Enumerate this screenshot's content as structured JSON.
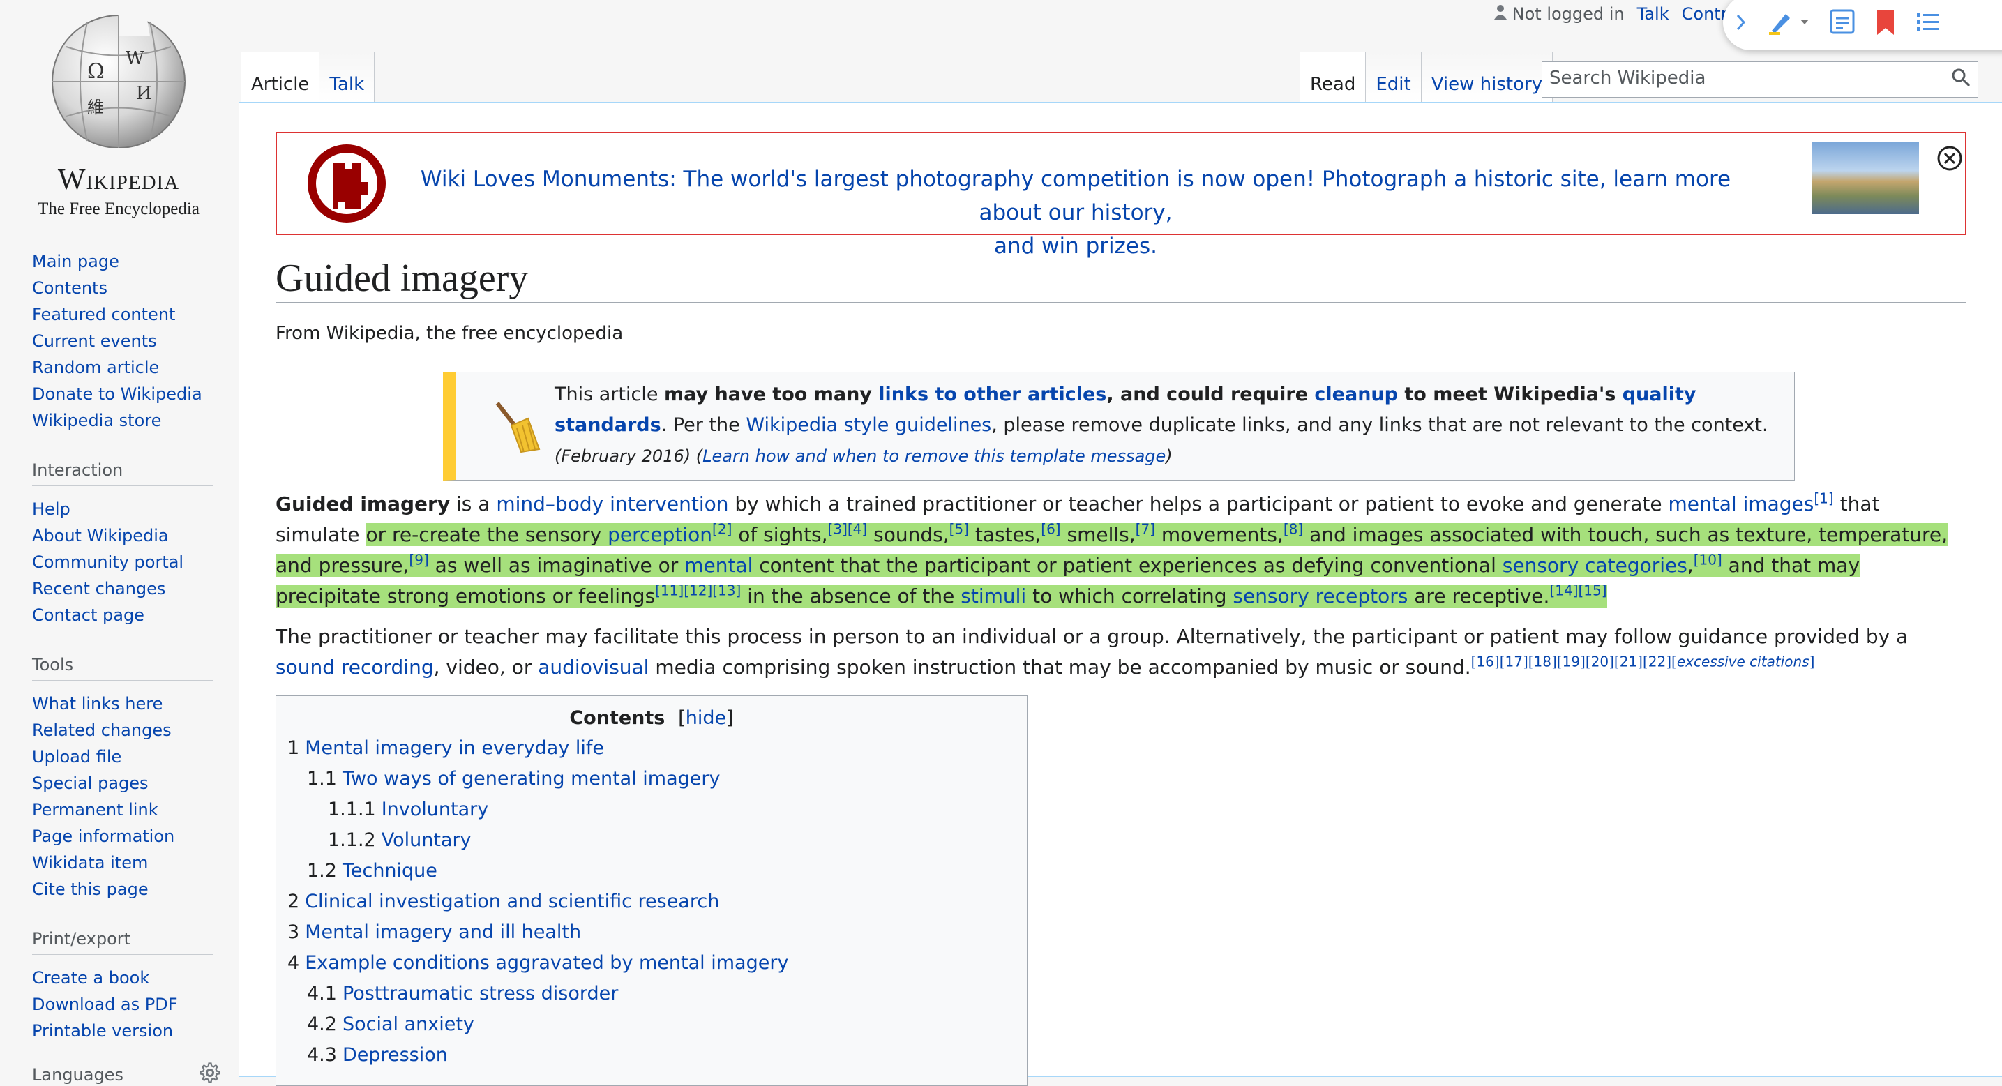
{
  "logo": {
    "wordmark": "Wikipedia",
    "tagline": "The Free Encyclopedia"
  },
  "personal": {
    "status": "Not logged in",
    "talk": "Talk",
    "contrib": "Contri"
  },
  "tabs": {
    "article": "Article",
    "talk": "Talk",
    "read": "Read",
    "edit": "Edit",
    "history": "View history"
  },
  "search": {
    "placeholder": "Search Wikipedia"
  },
  "sidebar": {
    "navigation": [
      "Main page",
      "Contents",
      "Featured content",
      "Current events",
      "Random article",
      "Donate to Wikipedia",
      "Wikipedia store"
    ],
    "interaction_heading": "Interaction",
    "interaction": [
      "Help",
      "About Wikipedia",
      "Community portal",
      "Recent changes",
      "Contact page"
    ],
    "tools_heading": "Tools",
    "tools": [
      "What links here",
      "Related changes",
      "Upload file",
      "Special pages",
      "Permanent link",
      "Page information",
      "Wikidata item",
      "Cite this page"
    ],
    "print_heading": "Print/export",
    "print": [
      "Create a book",
      "Download as PDF",
      "Printable version"
    ],
    "languages_heading": "Languages"
  },
  "banner": {
    "line1": "Wiki Loves Monuments: The world's largest photography competition is now open! Photograph a historic site, learn more about our history,",
    "line2": "and win prizes."
  },
  "page": {
    "title": "Guided imagery",
    "subtitle": "From Wikipedia, the free encyclopedia"
  },
  "ambox": {
    "t1": "This article ",
    "b1": "may have too many ",
    "l1": "links to other articles",
    "b2": ", and could require ",
    "l2": "cleanup",
    "b3": " to meet Wikipedia's ",
    "l3": "quality standards",
    "t2": ". Per the ",
    "l4": "Wikipedia style guidelines",
    "t3": ", please remove duplicate links, and any links that are not relevant to the context. ",
    "date": "(February 2016)",
    "learn_open": " (",
    "learn": "Learn how and when to remove this template message",
    "learn_close": ")"
  },
  "p1": {
    "bold": "Guided imagery",
    "t1": " is a ",
    "l1": "mind–body intervention",
    "t2": " by which a trained practitioner or teacher helps a participant or patient to evoke and generate ",
    "l2": "mental images",
    "r1": "[1]",
    "t3": " that simulate ",
    "h1": "or re-create the sensory ",
    "l3": "perception",
    "r2": "[2]",
    "h2": " of sights,",
    "r3": "[3][4]",
    "h3": " sounds,",
    "r5": "[5]",
    "h4": " tastes,",
    "r6": "[6]",
    "h5": " smells,",
    "r7": "[7]",
    "h6": " movements,",
    "r8": "[8]",
    "h7": " and images associated with touch, such as texture, temperature, and pressure,",
    "r9": "[9]",
    "h8": " as well as imaginative or ",
    "l4": "mental",
    "h9": " content that the participant or patient experiences as defying conventional ",
    "l5": "sensory categories",
    "h10": ",",
    "r10": "[10]",
    "h11": " and that may precipitate strong emotions or feelings",
    "r11": "[11][12][13]",
    "h12": " in the absence of the ",
    "l6": "stimuli",
    "h13": " to which correlating ",
    "l7": "sensory receptors",
    "h14": " are receptive.",
    "r14": "[14][15]"
  },
  "p2": {
    "t1": "The practitioner or teacher may facilitate this process in person to an individual or a group. Alternatively, the participant or patient may follow guidance provided by a ",
    "l1": "sound recording",
    "t2": ", video, or ",
    "l2": "audiovisual",
    "t3": " media comprising spoken instruction that may be accompanied by music or sound.",
    "refs": "[16][17][18][19][20][21][22]",
    "xs_open": "[",
    "xs": "excessive citations",
    "xs_close": "]"
  },
  "toc": {
    "title": "Contents",
    "hide_open": "[",
    "hide": "hide",
    "hide_close": "]",
    "items": [
      {
        "num": "1",
        "label": "Mental imagery in everyday life"
      },
      {
        "num": "1.1",
        "label": "Two ways of generating mental imagery"
      },
      {
        "num": "1.1.1",
        "label": "Involuntary"
      },
      {
        "num": "1.1.2",
        "label": "Voluntary"
      },
      {
        "num": "1.2",
        "label": "Technique"
      },
      {
        "num": "2",
        "label": "Clinical investigation and scientific research"
      },
      {
        "num": "3",
        "label": "Mental imagery and ill health"
      },
      {
        "num": "4",
        "label": "Example conditions aggravated by mental imagery"
      },
      {
        "num": "4.1",
        "label": "Posttraumatic stress disorder"
      },
      {
        "num": "4.2",
        "label": "Social anxiety"
      },
      {
        "num": "4.3",
        "label": "Depression"
      }
    ]
  },
  "colors": {
    "link": "#0645ad",
    "highlight": "#a6e07c",
    "banner_border": "#dd3333",
    "ambox_stripe": "#ffcc33"
  }
}
